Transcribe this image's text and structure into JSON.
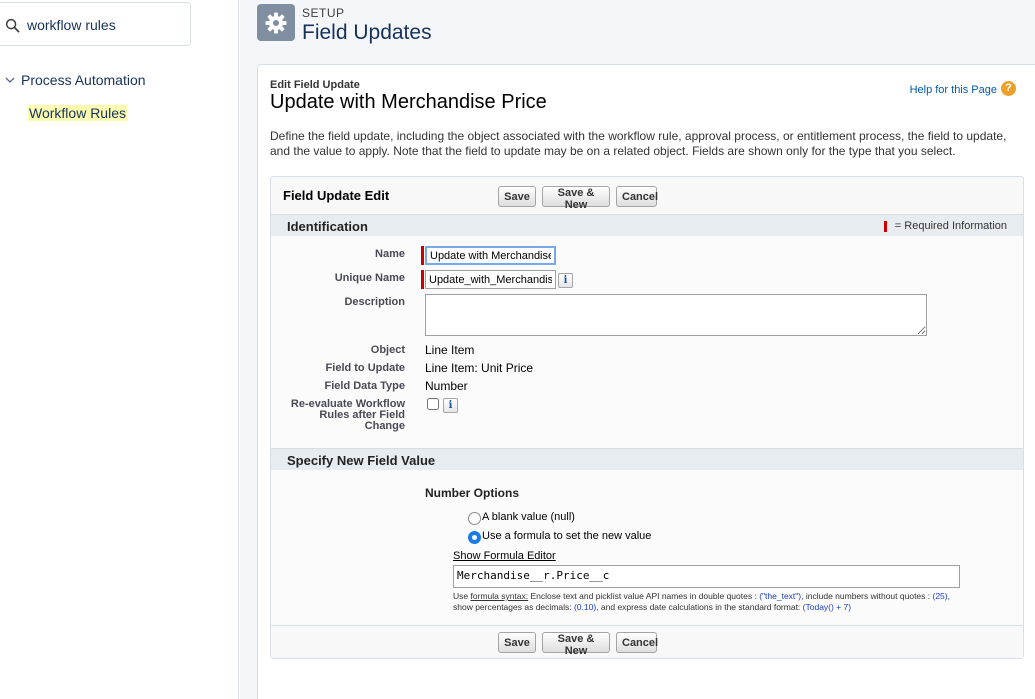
{
  "sidebar": {
    "search": {
      "value": "workflow rules",
      "placeholder": ""
    },
    "group_label": "Process Automation",
    "item_label": "Workflow Rules"
  },
  "header": {
    "eyebrow": "SETUP",
    "title": "Field Updates"
  },
  "record": {
    "edit_label": "Edit Field Update",
    "title": "Update with Merchandise Price",
    "help_link": "Help for this Page",
    "help_icon_glyph": "?",
    "description": "Define the field update, including the object associated with the workflow rule, approval process, or entitlement process, the field to update, and the value to apply. Note that the field to update may be on a related object. Fields are shown only for the type that you select."
  },
  "form": {
    "title": "Field Update Edit",
    "buttons": {
      "save": "Save",
      "save_new": "Save & New",
      "cancel": "Cancel"
    },
    "identification": {
      "section_title": "Identification",
      "required_legend": "= Required Information",
      "name_label": "Name",
      "name_value": "Update with Merchandise Price",
      "unique_name_label": "Unique Name",
      "unique_name_value": "Update_with_Merchandise_Price",
      "description_label": "Description",
      "description_value": "",
      "object_label": "Object",
      "object_value": "Line Item",
      "field_to_update_label": "Field to Update",
      "field_to_update_value": "Line Item: Unit Price",
      "field_data_type_label": "Field Data Type",
      "field_data_type_value": "Number",
      "reevaluate_label_line1": "Re-evaluate Workflow",
      "reevaluate_label_line2": "Rules after Field",
      "reevaluate_label_line3": "Change",
      "reevaluate_checked": false,
      "info_glyph": "i"
    },
    "new_value": {
      "section_title": "Specify New Field Value",
      "options_heading": "Number Options",
      "option_blank": "A blank value (null)",
      "option_formula": "Use a formula to set the new value",
      "selected_option": "formula",
      "formula_editor_link": "Show Formula Editor",
      "formula_value": "Merchandise__r.Price__c",
      "syntax_note": {
        "use": "Use ",
        "formula_syntax": "formula syntax:",
        "part1": " Enclose text and picklist value API names in double quotes : ",
        "ex_text": "(\"the_text\")",
        "part2": ", include numbers without quotes : ",
        "ex_number": "(25)",
        "part3": ", show percentages as decimals: ",
        "ex_percent": "(0.10)",
        "part4": ", and express date calculations in the standard format: ",
        "ex_date": "(Today() + 7)"
      }
    }
  }
}
